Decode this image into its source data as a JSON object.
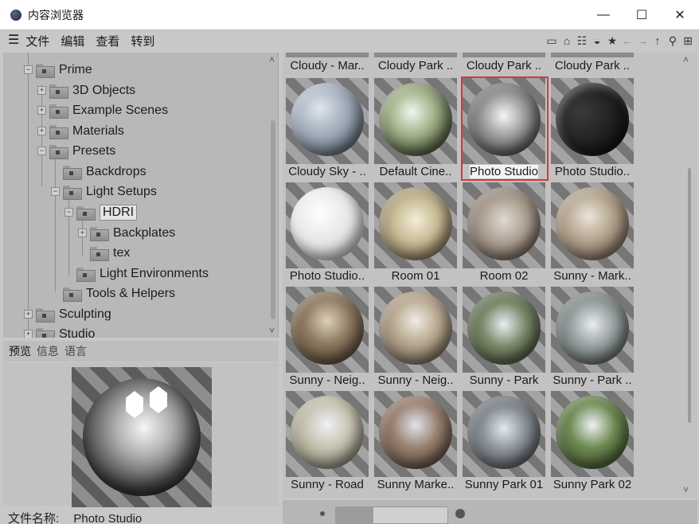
{
  "window": {
    "title": "内容浏览器",
    "minimize": "—",
    "maximize": "☐",
    "close": "✕"
  },
  "menu": {
    "items": [
      "文件",
      "编辑",
      "查看",
      "转到"
    ]
  },
  "toolbar": {
    "icons": [
      "list-view-icon",
      "home-icon",
      "filter-icon",
      "hdri-icon",
      "star-icon",
      "back-icon",
      "forward-icon",
      "up-icon",
      "search-icon",
      "add-icon"
    ]
  },
  "tree": {
    "items": [
      {
        "label": "Prime"
      },
      {
        "label": "3D Objects"
      },
      {
        "label": "Example Scenes"
      },
      {
        "label": "Materials"
      },
      {
        "label": "Presets"
      },
      {
        "label": "Backdrops"
      },
      {
        "label": "Light Setups"
      },
      {
        "label": "HDRI"
      },
      {
        "label": "Backplates"
      },
      {
        "label": "tex"
      },
      {
        "label": "Light Environments"
      },
      {
        "label": "Tools & Helpers"
      },
      {
        "label": "Sculpting"
      },
      {
        "label": "Studio"
      }
    ]
  },
  "tabs": [
    "预览",
    "信息",
    "语言"
  ],
  "file_name": {
    "label": "文件名称:",
    "value": "Photo Studio"
  },
  "grid": {
    "top_row": [
      "Cloudy - Mar..",
      "Cloudy Park ..",
      "Cloudy Park ..",
      "Cloudy Park .."
    ],
    "items": [
      {
        "label": "Cloudy Sky - ..",
        "ball": "radial-gradient(circle at 40% 35%, #dfe6ee 0%, #9aa6b4 45%, #3b4250 100%)"
      },
      {
        "label": "Default Cine..",
        "ball": "radial-gradient(circle at 45% 40%, #f2f6f0 0%, #a7b890 35%, #4e5a3a 75%, #2a2f22 100%)"
      },
      {
        "label": "Photo Studio",
        "ball": "radial-gradient(circle at 50% 45%, #f5f5f5 0%, #9a9a9a 40%, #202020 100%)",
        "selected": true
      },
      {
        "label": "Photo Studio..",
        "ball": "radial-gradient(circle at 35% 40%, #3a3a3a 0%, #151515 70%, #000 100%)"
      },
      {
        "label": "Photo Studio..",
        "ball": "radial-gradient(circle at 40% 35%, #ffffff 0%, #e6e6e6 45%, #a8a8a8 100%)"
      },
      {
        "label": "Room 01",
        "ball": "radial-gradient(circle at 50% 45%, #f4eed8 0%, #c8bb96 40%, #5a4b32 100%)"
      },
      {
        "label": "Room 02",
        "ball": "radial-gradient(circle at 50% 45%, #e0dad2 0%, #a89a8c 45%, #4a3f38 100%)"
      },
      {
        "label": "Sunny - Mark..",
        "ball": "radial-gradient(circle at 45% 40%, #ece6da 0%, #b3a48e 40%, #5b4c40 100%)"
      },
      {
        "label": "Sunny - Neig..",
        "ball": "radial-gradient(circle at 50% 40%, #dcd0ba 0%, #8e7a60 40%, #3b2f22 100%)"
      },
      {
        "label": "Sunny - Neig..",
        "ball": "radial-gradient(circle at 50% 40%, #f0ece4 0%, #b8a890 40%, #54483c 100%)"
      },
      {
        "label": "Sunny - Park",
        "ball": "radial-gradient(circle at 50% 45%, #e6eef4 0%, #7c8a6a 40%, #2c3222 100%)"
      },
      {
        "label": "Sunny - Park ..",
        "ball": "radial-gradient(circle at 50% 45%, #e8ecf0 0%, #98a0a0 40%, #3a4040 100%)"
      },
      {
        "label": "Sunny - Road",
        "ball": "radial-gradient(circle at 50% 40%, #eef2f6 0%, #c6c2b0 40%, #6a6454 100%)"
      },
      {
        "label": "Sunny Marke..",
        "ball": "radial-gradient(circle at 50% 40%, #dce4ee 0%, #9a8070 40%, #3e3028 100%)"
      },
      {
        "label": "Sunny Park 01",
        "ball": "radial-gradient(circle at 50% 45%, #e2e8ee 0%, #8a9098 40%, #34383c 100%)"
      },
      {
        "label": "Sunny Park 02",
        "ball": "radial-gradient(circle at 50% 40%, #eef2f4 0%, #6e8a52 40%, #2e3a20 100%)"
      }
    ]
  }
}
